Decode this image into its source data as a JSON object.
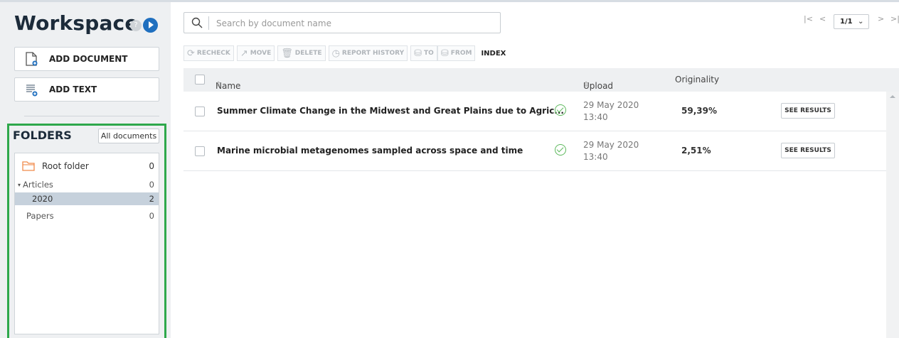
{
  "app": {
    "title": "Workspace"
  },
  "sidebar": {
    "add_document": "ADD DOCUMENT",
    "add_text": "ADD TEXT",
    "folders_title": "FOLDERS",
    "all_documents": "All documents",
    "folders": [
      {
        "name": "Root folder",
        "count": "0"
      },
      {
        "name": "Articles",
        "count": "0",
        "expanded": true
      },
      {
        "name": "2020",
        "count": "2",
        "selected": true
      },
      {
        "name": "Papers",
        "count": "0"
      }
    ]
  },
  "search": {
    "placeholder": "Search by document name",
    "value": ""
  },
  "toolbar": {
    "recheck": "RECHECK",
    "move": "MOVE",
    "delete": "DELETE",
    "report_history": "REPORT HISTORY",
    "to": "TO",
    "from": "FROM",
    "index": "INDEX"
  },
  "pager": {
    "current": "1/1"
  },
  "table": {
    "headers": {
      "name": "Name",
      "upload_date": "Upload date",
      "originality": "Originality"
    },
    "rows": [
      {
        "name": "Summer Climate Change in the Midwest and Great Plains due to Agric...",
        "date": "29 May 2020",
        "time": "13:40",
        "originality": "59,39%",
        "action": "SEE RESULTS"
      },
      {
        "name": "Marine microbial metagenomes sampled across space and time",
        "date": "29 May 2020",
        "time": "13:40",
        "originality": "2,51%",
        "action": "SEE RESULTS"
      }
    ]
  },
  "colors": {
    "highlight_border": "#2ea84b",
    "accent": "#1f6fbf",
    "selected_row": "#c6d1dc"
  }
}
